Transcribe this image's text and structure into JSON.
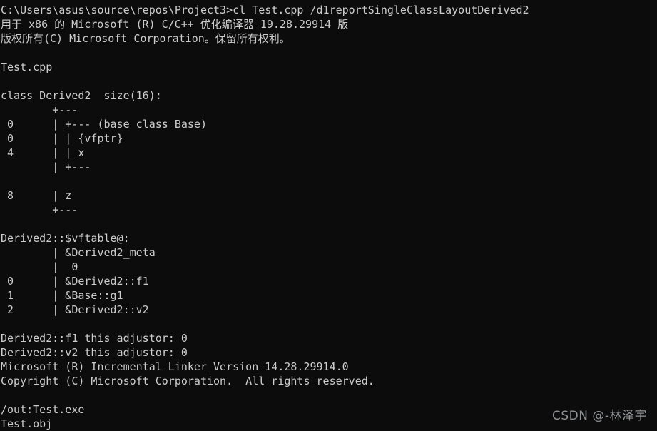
{
  "console": {
    "background_color": "#0c0c0c",
    "foreground_color": "#cccccc",
    "lines": [
      "C:\\Users\\asus\\source\\repos\\Project3>cl Test.cpp /d1reportSingleClassLayoutDerived2",
      "用于 x86 的 Microsoft (R) C/C++ 优化编译器 19.28.29914 版",
      "版权所有(C) Microsoft Corporation。保留所有权利。",
      "",
      "Test.cpp",
      "",
      "class Derived2\tsize(16):",
      "\t+---",
      " 0\t| +--- (base class Base)",
      " 0\t| | {vfptr}",
      " 4\t| | x",
      "\t| +---",
      "",
      " 8\t| z",
      "\t+---",
      "",
      "Derived2::$vftable@:",
      "\t| &Derived2_meta",
      "\t|  0",
      " 0\t| &Derived2::f1",
      " 1\t| &Base::g1",
      " 2\t| &Derived2::v2",
      "",
      "Derived2::f1 this adjustor: 0",
      "Derived2::v2 this adjustor: 0",
      "Microsoft (R) Incremental Linker Version 14.28.29914.0",
      "Copyright (C) Microsoft Corporation.  All rights reserved.",
      "",
      "/out:Test.exe",
      "Test.obj"
    ],
    "prompt_path": "C:\\Users\\asus\\source\\repos\\Project3",
    "command": "cl Test.cpp /d1reportSingleClassLayoutDerived2",
    "compiler_banner_line1": "用于 x86 的 Microsoft (R) C/C++ 优化编译器 19.28.29914 版",
    "compiler_banner_line2": "版权所有(C) Microsoft Corporation。保留所有权利。",
    "source_file": "Test.cpp",
    "class_layout": {
      "header": "class Derived2\tsize(16):",
      "class_name": "Derived2",
      "size": "16",
      "rows": [
        {
          "offset": "",
          "text": "\t+---"
        },
        {
          "offset": " 0",
          "text": " 0\t| +--- (base class Base)"
        },
        {
          "offset": " 0",
          "text": " 0\t| | {vfptr}"
        },
        {
          "offset": " 4",
          "text": " 4\t| | x"
        },
        {
          "offset": "",
          "text": "\t| +---"
        },
        {
          "offset": "",
          "text": ""
        },
        {
          "offset": " 8",
          "text": " 8\t| z"
        },
        {
          "offset": "",
          "text": "\t+---"
        }
      ]
    },
    "vftable": {
      "header": "Derived2::$vftable@:",
      "rows": [
        {
          "index": "",
          "entry": "\t| &Derived2_meta"
        },
        {
          "index": "",
          "entry": "\t|  0"
        },
        {
          "index": " 0",
          "entry": " 0\t| &Derived2::f1"
        },
        {
          "index": " 1",
          "entry": " 1\t| &Base::g1"
        },
        {
          "index": " 2",
          "entry": " 2\t| &Derived2::v2"
        }
      ]
    },
    "adjustors": [
      "Derived2::f1 this adjustor: 0",
      "Derived2::v2 this adjustor: 0"
    ],
    "linker_banner_line1": "Microsoft (R) Incremental Linker Version 14.28.29914.0",
    "linker_banner_line2": "Copyright (C) Microsoft Corporation.  All rights reserved.",
    "linker_out": "/out:Test.exe",
    "linker_obj": "Test.obj"
  },
  "watermark": {
    "text": "CSDN @-林泽宇",
    "color": "#8f9295"
  }
}
